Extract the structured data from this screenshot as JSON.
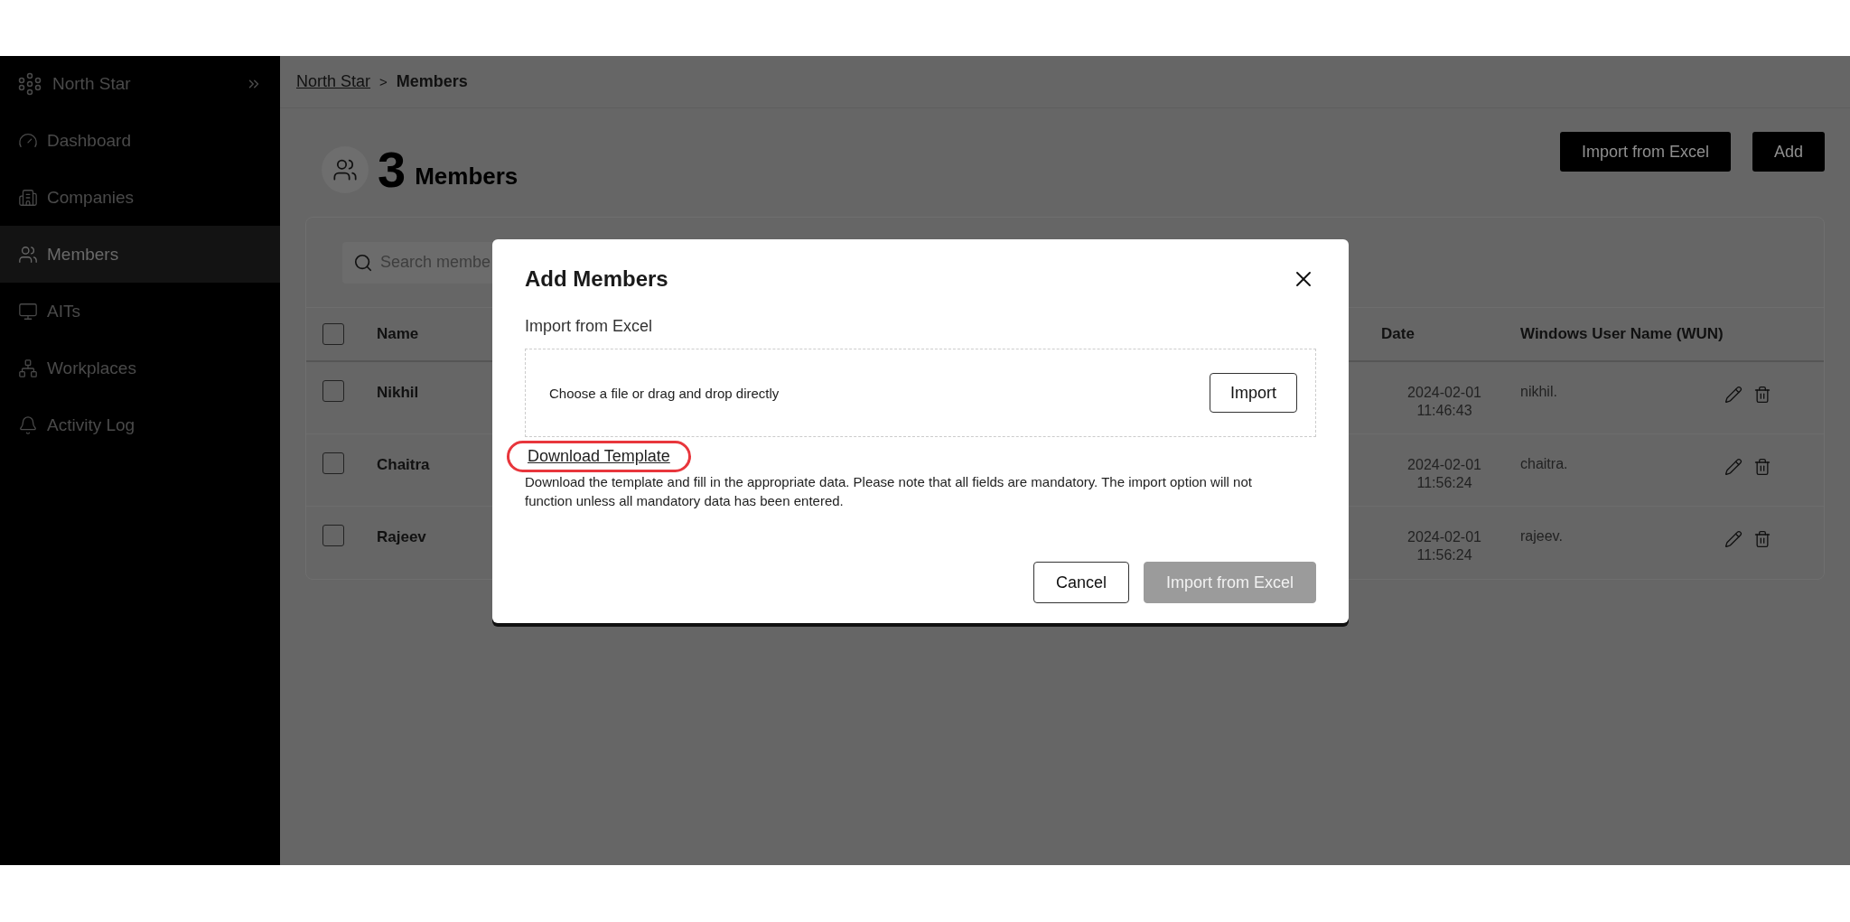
{
  "sidebar": {
    "brand": "North Star",
    "items": [
      {
        "label": "Dashboard",
        "selected": false
      },
      {
        "label": "Companies",
        "selected": false
      },
      {
        "label": "Members",
        "selected": true
      },
      {
        "label": "AITs",
        "selected": false
      },
      {
        "label": "Workplaces",
        "selected": false
      },
      {
        "label": "Activity Log",
        "selected": false
      }
    ]
  },
  "breadcrumb": {
    "parent": "North Star",
    "separator": ">",
    "current": "Members"
  },
  "header": {
    "count": "3",
    "title": "Members",
    "buttons": [
      "Import from Excel",
      "Add"
    ]
  },
  "search": {
    "placeholder": "Search membe"
  },
  "table": {
    "select_all_checked": false,
    "columns": [
      "Name",
      "Date",
      "Windows User Name (WUN)"
    ],
    "rows": [
      {
        "checked": false,
        "name": "Nikhil",
        "date": "2024-02-01",
        "time": "11:46:43",
        "wun": "nikhil."
      },
      {
        "checked": false,
        "name": "Chaitra",
        "date": "2024-02-01",
        "time": "11:56:24",
        "wun": "chaitra."
      },
      {
        "checked": false,
        "name": "Rajeev",
        "date": "2024-02-01",
        "time": "11:56:24",
        "wun": "rajeev."
      }
    ]
  },
  "modal": {
    "title": "Add Members",
    "section_label": "Import from Excel",
    "drop_text": "Choose a file or drag and drop directly",
    "import_button": "Import",
    "template_link": "Download Template",
    "template_highlighted": true,
    "note": "Download the template and fill in the appropriate data. Please note that all fields are mandatory. The import option will not function unless all mandatory data has been entered.",
    "buttons": [
      {
        "label": "Cancel",
        "disabled": false
      },
      {
        "label": "Import from Excel",
        "disabled": true
      }
    ]
  }
}
